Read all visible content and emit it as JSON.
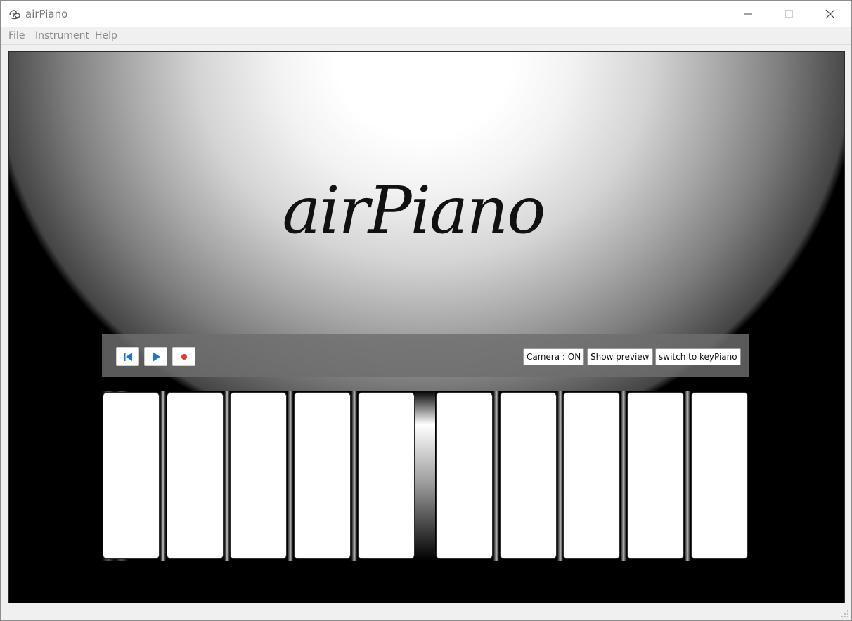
{
  "window": {
    "title": "airPiano"
  },
  "menu": {
    "items": [
      "File",
      "Instrument",
      "Help"
    ]
  },
  "logo": {
    "text": "airPiano"
  },
  "toolbar": {
    "prev_icon": "skip-back-icon",
    "play_icon": "play-icon",
    "record_icon": "record-icon",
    "camera_label": "Camera : ON",
    "preview_label": "Show preview",
    "switch_label": "switch to keyPiano"
  },
  "keys": {
    "count": 10
  },
  "colors": {
    "accent_blue": "#1976d2",
    "record_red": "#e53935",
    "menu_text": "#8a8a8a"
  }
}
